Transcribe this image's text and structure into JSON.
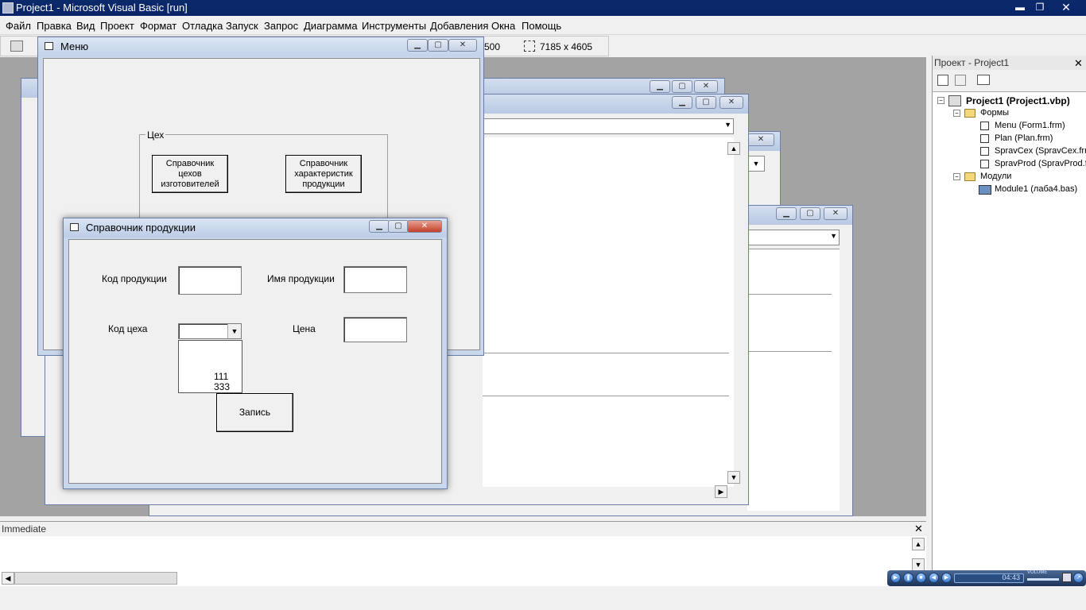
{
  "app": {
    "title": "Project1 - Microsoft Visual Basic [run]"
  },
  "menu": [
    "Файл",
    "Правка",
    "Вид",
    "Проект",
    "Формат",
    "Отладка",
    "Запуск",
    "Запрос",
    "Диаграмма",
    "Инструменты",
    "Добавления",
    "Окна",
    "Помощь"
  ],
  "toolbar": {
    "position_readout": "500",
    "size_readout": "7185 x 4605"
  },
  "menu_form": {
    "title": "Меню",
    "frame_label": "Цех",
    "btn_workshops": "Справочник цехов изготовителей",
    "btn_products": "Справочник характеристик продукции"
  },
  "product_form": {
    "title": "Справочник продукции",
    "code_label": "Код продукции",
    "name_label": "Имя продукции",
    "workshop_label": "Код цеха",
    "price_label": "Цена",
    "dropdown_options": [
      "111",
      "333"
    ],
    "save_button": "Запись"
  },
  "project_explorer": {
    "title": "Проект - Project1",
    "root": "Project1 (Project1.vbp)",
    "forms_folder": "Формы",
    "forms": [
      "Menu (Form1.frm)",
      "Plan (Plan.frm)",
      "SpravCex (SpravCex.frm)",
      "SpravProd (SpravProd.frm)"
    ],
    "modules_folder": "Модули",
    "modules": [
      "Module1 (лаба4.bas)"
    ]
  },
  "immediate": {
    "title": "Immediate"
  },
  "media": {
    "time": "04:43",
    "volume_label": "VOLUME"
  }
}
